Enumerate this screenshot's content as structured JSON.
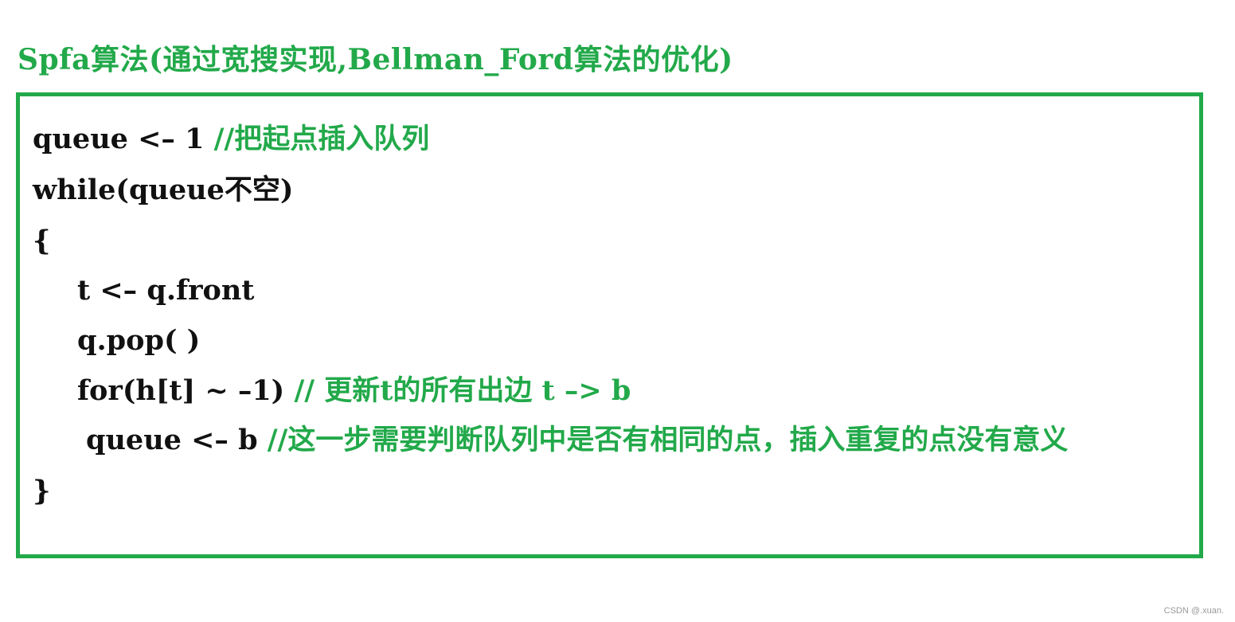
{
  "title": "Spfa算法(通过宽搜实现,Bellman_Ford算法的优化)",
  "lines": [
    {
      "code": "queue <– 1  ",
      "comment": "//把起点插入队列"
    },
    {
      "code": "while(queue不空)",
      "comment": ""
    },
    {
      "code": "{",
      "comment": ""
    },
    {
      "code": "t <– q.front",
      "comment": ""
    },
    {
      "code": "q.pop( )",
      "comment": ""
    },
    {
      "code": "for(h[t] ~ –1) ",
      "comment": "// 更新t的所有出边 t –> b"
    },
    {
      "code": "queue <– b ",
      "comment": "//这一步需要判断队列中是否有相同的点，插入重复的点没有意义"
    },
    {
      "code": "}",
      "comment": ""
    }
  ],
  "watermark": "CSDN @.xuan.",
  "colors": {
    "accent": "#22a94a",
    "text": "#111111"
  }
}
